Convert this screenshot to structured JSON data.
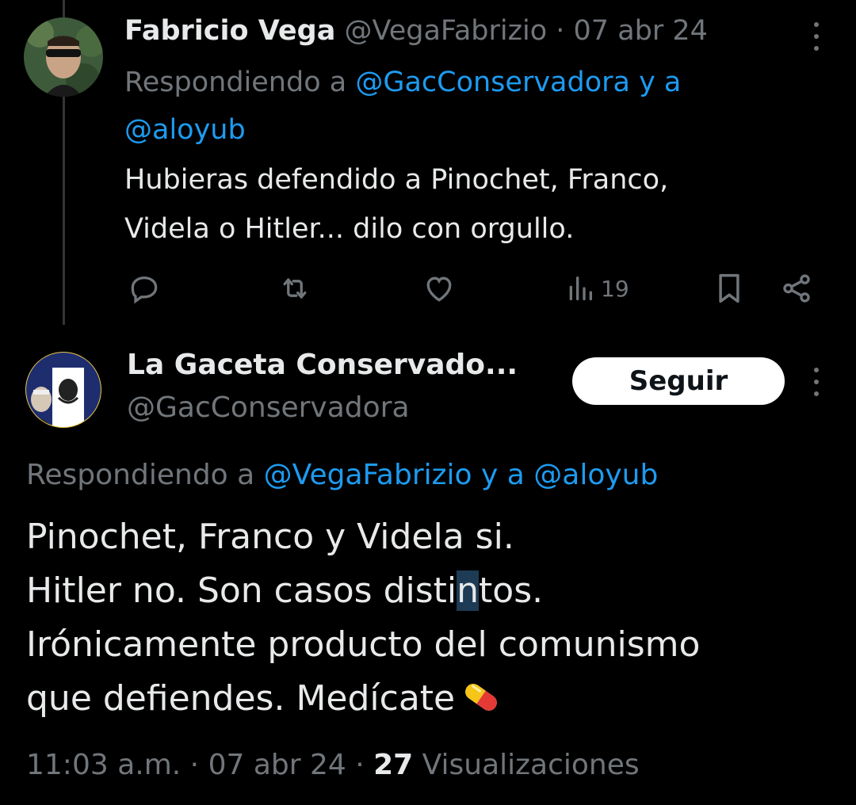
{
  "reply_tweet": {
    "author_name": "Fabricio Vega",
    "author_handle": "@VegaFabrizio",
    "separator": " · ",
    "date": "07 abr 24",
    "replying_prefix": "Respondiendo a ",
    "replying_to_1": "@GacConservadora",
    "replying_joiner": " y a",
    "replying_to_2": "@aloyub",
    "text_line_1": "Hubieras defendido a Pinochet, Franco,",
    "text_line_2": "Videla o Hitler... dilo con orgullo.",
    "views_count": "19",
    "icons": [
      "more-icon",
      "reply-icon",
      "retweet-icon",
      "like-icon",
      "views-icon",
      "bookmark-icon",
      "share-icon"
    ]
  },
  "main_tweet": {
    "author_name": "La Gaceta Conservado...",
    "author_handle": "@GacConservadora",
    "follow_label": "Seguir",
    "replying_prefix": "Respondiendo a ",
    "replying_to_1": "@VegaFabrizio",
    "replying_joiner": " y a ",
    "replying_to_2": "@aloyub",
    "text_line_1": "Pinochet, Franco y Videla si.",
    "text_line_2_a": "Hitler no. Son casos disti",
    "text_line_2_hl": "n",
    "text_line_2_b": "tos.",
    "text_line_3": "Irónicamente producto del comunismo",
    "text_line_4": "que defiendes. Medícate",
    "emoji": "pill-emoji",
    "time": "11:03 a.m.",
    "separator_1": " · ",
    "date": "07 abr 24",
    "separator_2": " · ",
    "views_count": "27",
    "views_label": " Visualizaciones"
  },
  "colors": {
    "background": "#000000",
    "text": "#e7e9ea",
    "muted": "#71767b",
    "link": "#1d9bf0",
    "follow_bg": "#ffffff",
    "highlight": "#1d3b55"
  }
}
